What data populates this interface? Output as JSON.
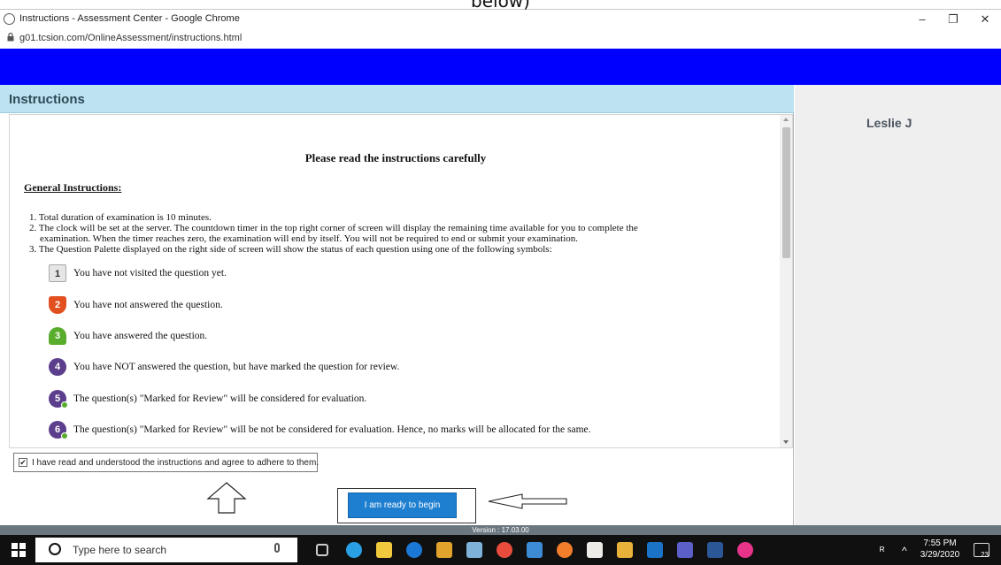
{
  "caption_partial": "below)",
  "window": {
    "title": "Instructions - Assessment Center - Google Chrome",
    "url": "g01.tcsion.com/OnlineAssessment/instructions.html",
    "minimize": "–",
    "restore": "❐",
    "close": "✕"
  },
  "panel": {
    "header": "Instructions",
    "heading": "Please read the instructions carefully",
    "general_title": "General Instructions:",
    "points": [
      "1. Total duration of examination is 10 minutes.",
      "2. The clock will be set at the server. The countdown timer in the top right corner of screen will display the remaining time available for you to complete the",
      "examination. When the timer reaches zero, the examination will end by itself. You will not be required to end or submit your examination.",
      "3. The Question Palette displayed on the right side of screen will show the status of each question using one of the following symbols:"
    ],
    "legend": [
      {
        "num": "1",
        "text": "You have not visited the question yet."
      },
      {
        "num": "2",
        "text": "You have not answered the question."
      },
      {
        "num": "3",
        "text": "You have answered the question."
      },
      {
        "num": "4",
        "text": "You have NOT answered the question, but have marked the question for review."
      },
      {
        "num": "5",
        "text": "The question(s) \"Marked for Review\" will be considered for evaluation."
      },
      {
        "num": "6",
        "text": "The question(s) \"Marked for Review\" will be not be considered for evaluation. Hence, no marks will be allocated for the same."
      }
    ],
    "agree_label": "I have read and understood the instructions and agree to adhere to them.",
    "agree_checked": "✔",
    "ready_button": "I am ready to begin",
    "version": "Version : 17.03.00"
  },
  "sidebar": {
    "user_name": "Leslie J"
  },
  "taskbar": {
    "search_placeholder": "Type here to search",
    "time": "7:55 PM",
    "date": "3/29/2020",
    "notifications": "23",
    "colors": {
      "bg": "#101010",
      "accent": "#1e7fd0"
    }
  }
}
